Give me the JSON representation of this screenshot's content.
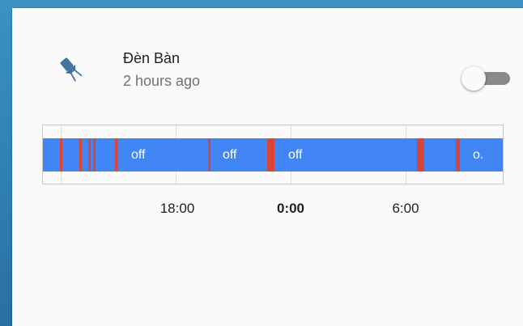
{
  "entity": {
    "name": "Đèn Bàn",
    "last_changed": "2 hours ago",
    "icon": "desk-lamp-icon",
    "toggle_state": "off"
  },
  "timeline": {
    "on_color": "#db4437",
    "off_color": "#4286f5",
    "segment_labels": [
      "off",
      "off",
      "off",
      "o."
    ],
    "axis_ticks": [
      {
        "label": "18:00",
        "bold": false
      },
      {
        "label": "0:00",
        "bold": true
      },
      {
        "label": "6:00",
        "bold": false
      }
    ]
  }
}
